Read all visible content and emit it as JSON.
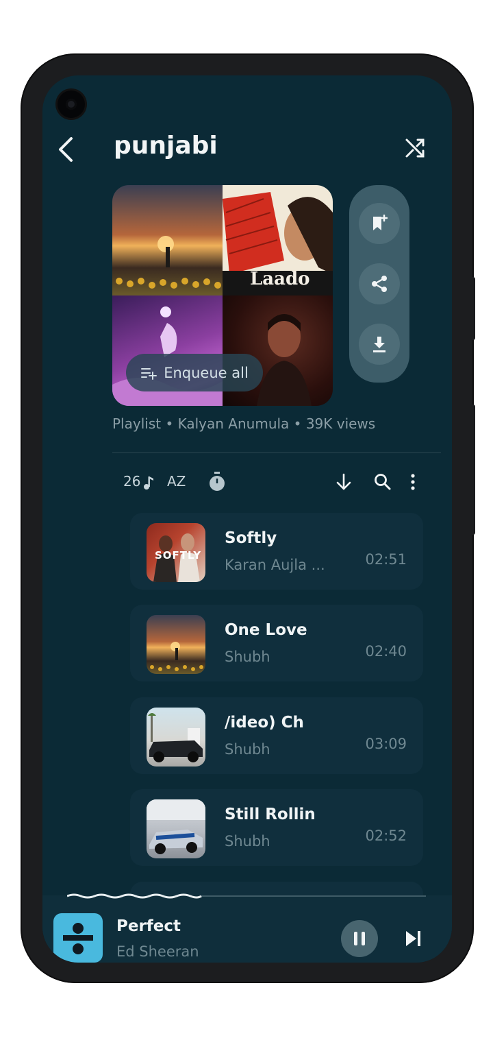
{
  "header": {
    "title": "punjabi"
  },
  "cover": {
    "laado_text": "Laado",
    "enqueue_label": "Enqueue all"
  },
  "meta": {
    "text": "Playlist • Kalyan Anumula • 39K views"
  },
  "toolbar": {
    "count": "26",
    "sort_label": "AZ"
  },
  "songs": [
    {
      "title": "Softly",
      "artist": "Karan Aujla ...",
      "duration": "02:51",
      "thumb_text": "SOFTLY"
    },
    {
      "title": "One Love",
      "artist": "Shubh",
      "duration": "02:40"
    },
    {
      "title": "/ideo)      Ch",
      "artist": "Shubh",
      "duration": "03:09"
    },
    {
      "title": "Still Rollin",
      "artist": "Shubh",
      "duration": "02:52"
    }
  ],
  "player": {
    "title": "Perfect",
    "artist": "Ed Sheeran"
  },
  "colors": {
    "background": "#0b2a36",
    "card": "#102f3d",
    "accent_panel": "#3d5d69"
  }
}
